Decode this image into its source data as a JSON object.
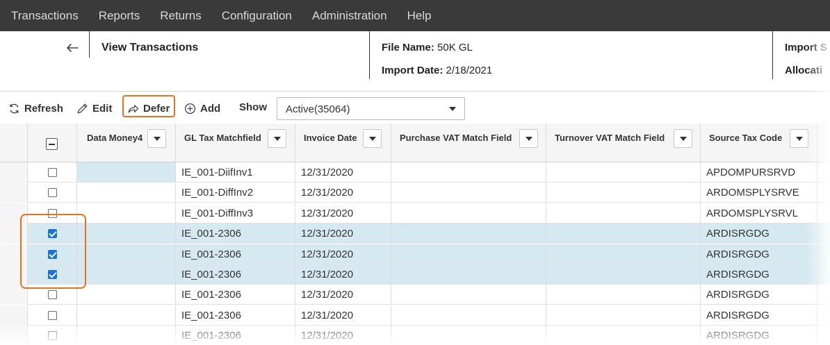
{
  "nav": {
    "items": [
      "Transactions",
      "Reports",
      "Returns",
      "Configuration",
      "Administration",
      "Help"
    ]
  },
  "header": {
    "title": "View Transactions",
    "file_name_label": "File Name:",
    "file_name_value": "50K GL",
    "import_date_label": "Import Date:",
    "import_date_value": "2/18/2021",
    "import_s_label": "Import S",
    "allocation_label": "Allocati"
  },
  "toolbar": {
    "refresh_label": "Refresh",
    "edit_label": "Edit",
    "defer_label": "Defer",
    "add_label": "Add",
    "show_label": "Show",
    "show_value": "Active(35064)"
  },
  "grid": {
    "columns": [
      "Data Money4",
      "GL Tax Matchfield",
      "Invoice Date",
      "Purchase VAT Match Field",
      "Turnover VAT Match Field",
      "Source Tax Code"
    ],
    "rows": [
      {
        "checked": false,
        "selected": false,
        "gl": "IE_001-DiifInv1",
        "date": "12/31/2020",
        "src": "APDOMPURSRVD"
      },
      {
        "checked": false,
        "selected": false,
        "gl": "IE_001-DiffInv2",
        "date": "12/31/2020",
        "src": "ARDOMSPLYSRVE"
      },
      {
        "checked": false,
        "selected": false,
        "gl": "IE_001-DiffInv3",
        "date": "12/31/2020",
        "src": "ARDOMSPLYSRVL"
      },
      {
        "checked": true,
        "selected": true,
        "gl": "IE_001-2306",
        "date": "12/31/2020",
        "src": "ARDISRGDG"
      },
      {
        "checked": true,
        "selected": true,
        "gl": "IE_001-2306",
        "date": "12/31/2020",
        "src": "ARDISRGDG"
      },
      {
        "checked": true,
        "selected": true,
        "gl": "IE_001-2306",
        "date": "12/31/2020",
        "src": "ARDISRGDG"
      },
      {
        "checked": false,
        "selected": false,
        "gl": "IE_001-2306",
        "date": "12/31/2020",
        "src": "ARDISRGDG"
      },
      {
        "checked": false,
        "selected": false,
        "gl": "IE_001-2306",
        "date": "12/31/2020",
        "src": "ARDISRGDG"
      },
      {
        "checked": false,
        "selected": false,
        "gl": "IE_001-2306",
        "date": "12/31/2020",
        "src": "ARDISRGDG"
      }
    ]
  },
  "colors": {
    "nav_bg": "#3a3a3a",
    "highlight": "#e8711f",
    "selected_row": "#d6e9f0",
    "checkbox_on": "#1a73d9"
  }
}
